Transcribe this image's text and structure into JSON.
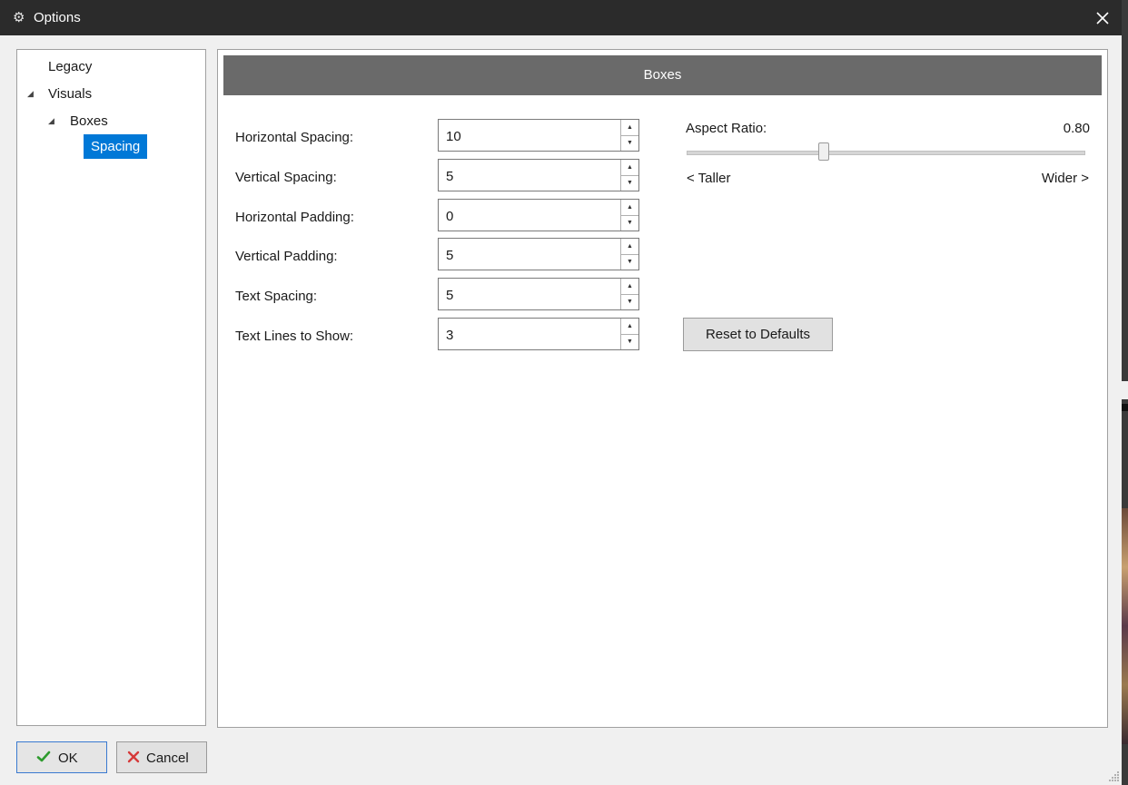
{
  "window": {
    "title": "Options",
    "icon": "gear-icon"
  },
  "tree": {
    "items": [
      {
        "label": "Legacy",
        "expanded": null
      },
      {
        "label": "Visuals",
        "expanded": true
      },
      {
        "label": "Boxes",
        "expanded": true
      },
      {
        "label": "Spacing",
        "selected": true
      }
    ]
  },
  "section": {
    "header": "Boxes"
  },
  "fields": [
    {
      "label": "Horizontal Spacing:",
      "value": "10"
    },
    {
      "label": "Vertical Spacing:",
      "value": "5"
    },
    {
      "label": "Horizontal Padding:",
      "value": "0"
    },
    {
      "label": "Vertical Padding:",
      "value": "5"
    },
    {
      "label": "Text Spacing:",
      "value": "5"
    },
    {
      "label": "Text Lines to Show:",
      "value": "3"
    }
  ],
  "aspect": {
    "label": "Aspect Ratio:",
    "value": "0.80",
    "left_label": "< Taller",
    "right_label": "Wider >"
  },
  "buttons": {
    "reset": "Reset to Defaults",
    "ok": "OK",
    "cancel": "Cancel"
  },
  "colors": {
    "accent": "#0078d7",
    "header": "#6a6a6a",
    "titlebar": "#2b2b2b",
    "ok_check": "#2e9b2e",
    "cancel_x": "#d63a3a"
  }
}
